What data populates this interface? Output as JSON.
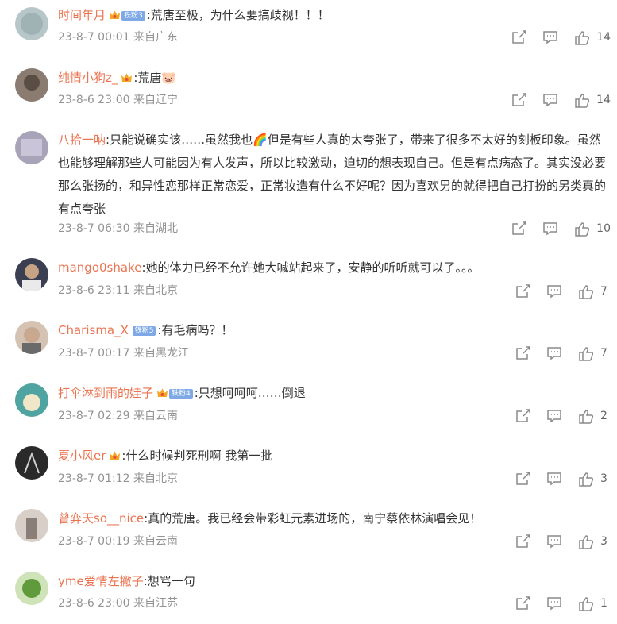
{
  "comments": [
    {
      "user": "时间年月",
      "crown": true,
      "fan": "铁粉3",
      "text": ":荒唐至极，为什么要搞歧视！！！",
      "date": "23-8-7 00:01",
      "location": "来自广东",
      "likes": "14",
      "avatar_color": "#b7c7c9"
    },
    {
      "user": "纯情小狗z_",
      "crown": true,
      "fan": "",
      "text": ":荒唐🐷",
      "date": "23-8-6 23:00",
      "location": "来自辽宁",
      "likes": "14",
      "avatar_color": "#8a7c70"
    },
    {
      "user": "八拾一呐",
      "crown": false,
      "fan": "",
      "text": ":只能说确实该……虽然我也🌈但是有些人真的太夸张了，带来了很多不太好的刻板印象。虽然也能够理解那些人可能因为有人发声，所以比较激动，迫切的想表现自己。但是有点病态了。其实没必要那么张扬的，和异性恋那样正常恋爱，正常妆造有什么不好呢？因为喜欢男的就得把自己打扮的另类真的有点夸张",
      "date": "23-8-7 06:30",
      "location": "来自湖北",
      "likes": "10",
      "avatar_color": "#a8a3b8"
    },
    {
      "user": "mango0shake",
      "crown": false,
      "fan": "",
      "text": ":她的体力已经不允许她大喊站起来了，安静的听听就可以了。。。",
      "date": "23-8-6 23:11",
      "location": "来自北京",
      "likes": "7",
      "avatar_color": "#3a3f52"
    },
    {
      "user": "Charisma_X",
      "crown": false,
      "fan": "铁粉5",
      "text": ":有毛病吗？！",
      "date": "23-8-7 00:17",
      "location": "来自黑龙江",
      "likes": "7",
      "avatar_color": "#c9a890"
    },
    {
      "user": "打伞淋到雨的娃子",
      "crown": true,
      "fan": "铁粉4",
      "text": ":只想呵呵呵……倒退",
      "date": "23-8-7 02:29",
      "location": "来自云南",
      "likes": "2",
      "avatar_color": "#4fa3a0"
    },
    {
      "user": "夏小风er",
      "crown": true,
      "fan": "",
      "text": ":什么时候判死刑啊 我第一批",
      "date": "23-8-7 01:12",
      "location": "来自北京",
      "likes": "3",
      "avatar_color": "#2a2a2a"
    },
    {
      "user": "曾弈天so__nice",
      "crown": false,
      "fan": "",
      "text": ":真的荒唐。我已经会带彩虹元素进场的，南宁蔡依林演唱会见！",
      "date": "23-8-7 00:19",
      "location": "来自云南",
      "likes": "3",
      "avatar_color": "#d8d0c8"
    },
    {
      "user": "yme爱情左撇子",
      "crown": false,
      "fan": "",
      "text": ":想骂一句",
      "date": "23-8-6 23:00",
      "location": "来自江苏",
      "likes": "1",
      "avatar_color": "#5f9a3c"
    }
  ],
  "icons": {
    "share": "share-icon",
    "reply": "comment-icon",
    "like": "thumbs-up-icon",
    "crown": "crown-icon"
  },
  "colors": {
    "username": "#eb7350",
    "meta": "#939393",
    "fan_badge": "#7fa9e6"
  }
}
